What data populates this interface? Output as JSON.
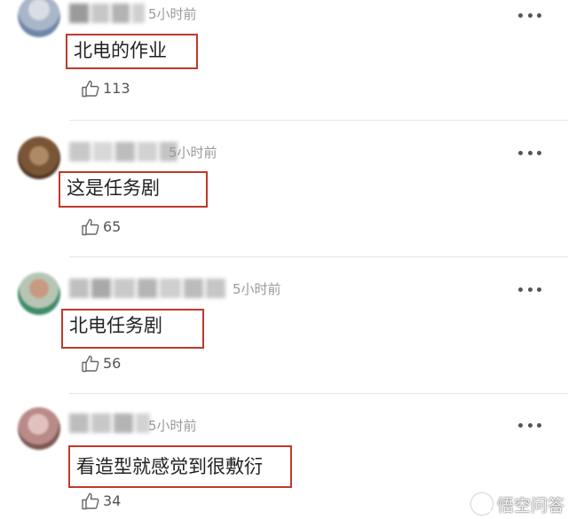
{
  "comments": [
    {
      "text": "北电的作业",
      "time": "5小时前",
      "likes": "113"
    },
    {
      "text": "这是任务剧",
      "time": "5小时前",
      "likes": "65"
    },
    {
      "text": "北电任务剧",
      "time": "5小时前",
      "likes": "56"
    },
    {
      "text": "看造型就感觉到很敷衍",
      "time": "5小时前",
      "likes": "34"
    }
  ],
  "watermark": {
    "text": "悟空问答"
  },
  "icons": {
    "like": "thumbs-up-icon",
    "more": "more-horizontal-icon",
    "watermark": "wukong-logo-icon"
  },
  "colors": {
    "highlight_border": "#c0392b",
    "time_text": "#9a9a9a",
    "divider": "#e6e6e6"
  }
}
